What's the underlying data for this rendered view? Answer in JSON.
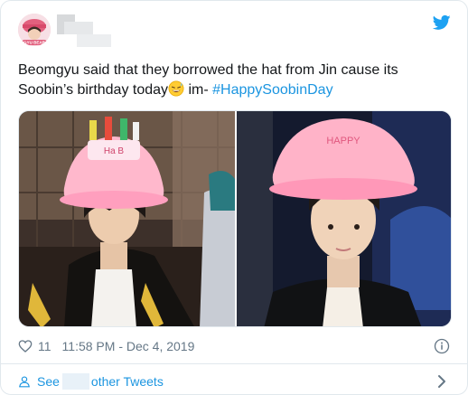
{
  "tweet": {
    "text_part1": "Beomgyu said that they borrowed the hat from Jin cause its Soobin’s birthday today",
    "text_part2": " im- ",
    "hashtag": "#HappySoobinDay",
    "emoji_icon": "grinning-sweat-emoji",
    "likes": "11",
    "timestamp": "11:58 PM - Dec 4, 2019"
  },
  "avatar": {
    "icon": "profile-avatar",
    "caption": "GYU BEAR"
  },
  "footer": {
    "see_label": "See",
    "other_tweets_label": "other Tweets"
  },
  "colors": {
    "accent": "#1b95e0",
    "muted": "#657786",
    "border": "#e1e8ed",
    "text": "#14171a"
  }
}
